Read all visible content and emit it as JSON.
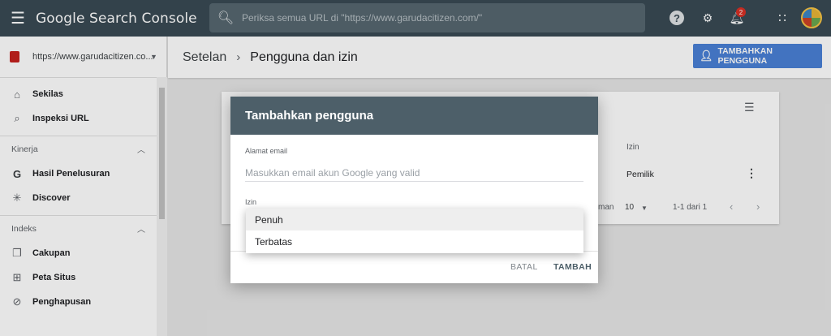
{
  "topbar": {
    "menu_icon": "menu-icon",
    "app_title": "Google Search Console",
    "search_placeholder": "Periksa semua URL di \"https://www.garudacitizen.com/\"",
    "notification_count": "2"
  },
  "sidebar": {
    "property": "https://www.garudacitizen.co...",
    "items_top": [
      {
        "label": "Sekilas",
        "icon": "home-icon"
      },
      {
        "label": "Inspeksi URL",
        "icon": "search-icon"
      }
    ],
    "sections": [
      {
        "title": "Kinerja",
        "items": [
          {
            "label": "Hasil Penelusuran",
            "icon": "google-g-icon"
          },
          {
            "label": "Discover",
            "icon": "discover-icon"
          }
        ]
      },
      {
        "title": "Indeks",
        "items": [
          {
            "label": "Cakupan",
            "icon": "copy-icon"
          },
          {
            "label": "Peta Situs",
            "icon": "sitemap-icon"
          },
          {
            "label": "Penghapusan",
            "icon": "eye-off-icon"
          }
        ]
      }
    ]
  },
  "header": {
    "breadcrumb_1": "Setelan",
    "breadcrumb_2": "Pengguna dan izin",
    "add_user_label": "TAMBAHKAN PENGGUNA"
  },
  "table": {
    "col_permission": "Izin",
    "row_permission": "Pemilik",
    "rows_label_partial": "man",
    "rows_per_page": "10",
    "range": "1-1 dari 1"
  },
  "dialog": {
    "title": "Tambahkan pengguna",
    "email_label": "Alamat email",
    "email_placeholder": "Masukkan email akun Google yang valid",
    "permission_label": "Izin",
    "options": [
      "Penuh",
      "Terbatas"
    ],
    "selected_option": "Penuh",
    "cancel_label": "BATAL",
    "add_label": "TAMBAH"
  },
  "colors": {
    "topbar": "#394a54",
    "dialog_header": "#4d5f69",
    "primary_button": "#4a80d6"
  }
}
